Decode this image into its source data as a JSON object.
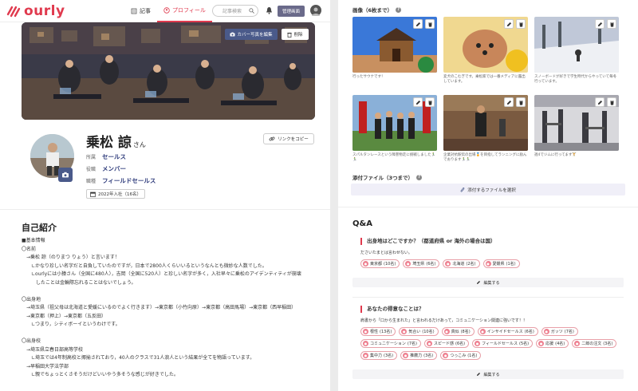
{
  "nav": {
    "logo": "ourly",
    "tab_articles": "記事",
    "tab_profile": "プロフィール",
    "search_placeholder": "記事検索",
    "admin_label": "管理画面"
  },
  "cover": {
    "edit_label": "カバー写真を編集",
    "delete_label": "削除"
  },
  "profile": {
    "name": "乗松 諒",
    "honorific": "さん",
    "copy_link": "リンクをコピー",
    "attributes": [
      {
        "key": "所属",
        "value": "セールス"
      },
      {
        "key": "役職",
        "value": "メンバー"
      },
      {
        "key": "職種",
        "value": "フィールドセールス"
      }
    ],
    "joined": "2022年入社（16名）"
  },
  "intro": {
    "title": "自己紹介",
    "lines": [
      "■基本情報",
      "〇名前",
      "　→乗松 諒（のりまつ りょう）と言います！",
      "　　∟かなり珍しい名字だと自負していたのですが，日本で2800人くらいいるというなんとも微妙な人数でした。",
      "　　∟ourlyには小猿さん（全国に480人），吉岡（全国に520人）と珍しい名字が多く，入社早々に乗松のアイデンティティが崩壊",
      "　　　したことは金輪際忘れることはないでしょう。",
      "",
      "〇出身地",
      "　→埼玉県（祖父母は北海道と愛媛にいるのでよく行きます）→東京都（小竹向原）→東京都（高田馬場）→東京都（西早稲田）",
      "　→東京都（押上）→東京都（五反田）",
      "　　∟つまり，シティボーイというわけです。",
      "",
      "〇出身校",
      "　→埼玉県立春日部高等学校",
      "　　∟埼玉では4年制高校と揶揄されており，40人のクラスで31人浪人という結果が全てを物語っています。",
      "　→早稲田大学法学部",
      "　　∟親でちょっとくさそうだけどいいやう多そうな感じが好きでした。"
    ]
  },
  "images": {
    "title": "画像（6枚まで）",
    "captions": [
      "行ったサウナです！",
      "変犬のこむぎです。乗松家では一番メディアに露出しています。",
      "スノーボードが好きで学生時代からやっていて毎冬行っています。",
      "スパルタンレースという障害物走に挑戦しました🏃‍♂️🏃‍♂️",
      "企業対抗駅伝の出場🏅を目指してランニングに励んでおります🏃‍♂️🏃‍♂️",
      "週4でジムに行ってます🏋️"
    ]
  },
  "attachments": {
    "title": "添付ファイル（3つまで）",
    "select_label": "添付するファイルを選択"
  },
  "qa": {
    "title": "Q&A",
    "edit_label": "編集する",
    "questions": [
      {
        "question": "出身地はどこですか？（都道府県 or 海外の場合は国）",
        "desc": "ださいたまとは言わせない。",
        "tags": [
          {
            "label": "東京都",
            "count": "(10名)"
          },
          {
            "label": "埼玉県",
            "count": "(6名)"
          },
          {
            "label": "北海道",
            "count": "(2名)"
          },
          {
            "label": "愛媛県",
            "count": "(1名)"
          }
        ]
      },
      {
        "question": "あなたの得意なことは？",
        "desc": "肩書から「口から生まれた」と言われるだけあって，コミュニケーション関連に強いです！！",
        "tags": [
          {
            "label": "根性",
            "count": "(13名)"
          },
          {
            "label": "気合い",
            "count": "(10名)"
          },
          {
            "label": "真似",
            "count": "(8名)"
          },
          {
            "label": "インサイドセールス",
            "count": "(6名)"
          },
          {
            "label": "ガッツ",
            "count": "(7名)"
          },
          {
            "label": "コミュニケーション",
            "count": "(7名)"
          },
          {
            "label": "スピード感",
            "count": "(6名)"
          },
          {
            "label": "フィールドセールス",
            "count": "(5名)"
          },
          {
            "label": "応援",
            "count": "(4名)"
          },
          {
            "label": "二郎の注文",
            "count": "(3名)"
          },
          {
            "label": "集中力",
            "count": "(3名)"
          },
          {
            "label": "推薦力",
            "count": "(3名)"
          },
          {
            "label": "つっこみ",
            "count": "(1名)"
          }
        ]
      }
    ]
  },
  "colors": {
    "brand": "#e03a4e",
    "navy": "#2d3a7a",
    "admin": "#6a6a8a"
  },
  "icons": [
    "ourly-logo-icon",
    "article-icon",
    "profile-icon",
    "search-icon",
    "bell-icon",
    "camera-icon",
    "trash-icon",
    "link-icon",
    "calendar-icon",
    "pencil-icon",
    "clip-icon",
    "help-icon"
  ]
}
